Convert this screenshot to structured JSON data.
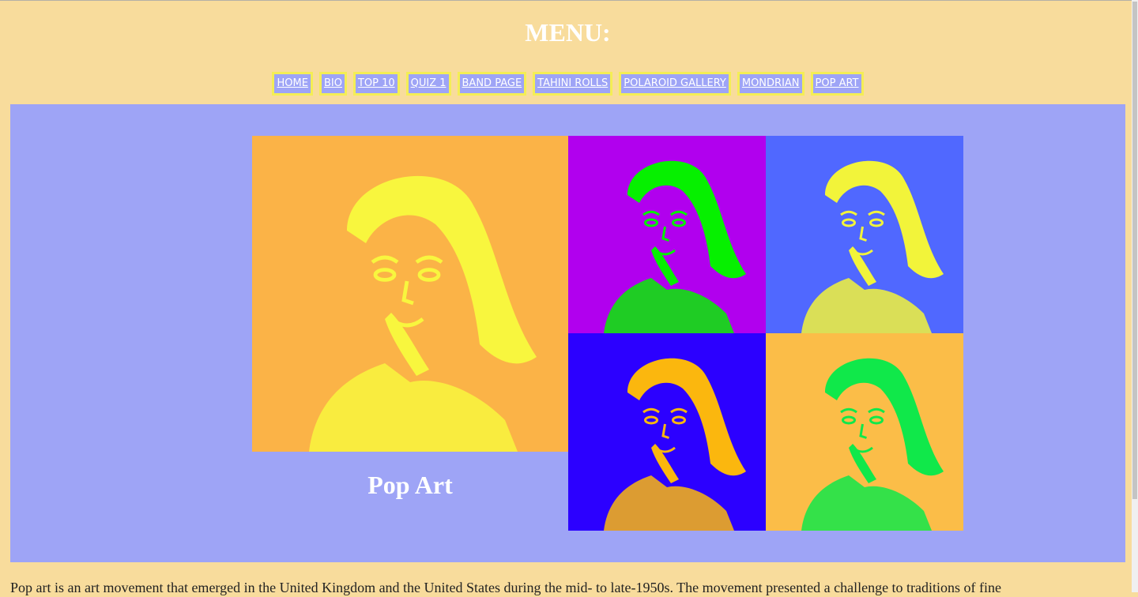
{
  "header": {
    "menu_title": "MENU:"
  },
  "nav": {
    "items": [
      {
        "label": "HOME"
      },
      {
        "label": "BIO"
      },
      {
        "label": "TOP 10"
      },
      {
        "label": "QUIZ 1"
      },
      {
        "label": "BAND PAGE"
      },
      {
        "label": "TAHINI ROLLS"
      },
      {
        "label": "POLAROID GALLERY"
      },
      {
        "label": "MONDRIAN"
      },
      {
        "label": "POP ART"
      }
    ]
  },
  "gallery": {
    "caption": "Pop Art",
    "tiles": [
      {
        "background": "#fbb347",
        "figure": "#f8f63e"
      },
      {
        "background": "#b100ee",
        "figure": "#06f000"
      },
      {
        "background": "#5068ff",
        "figure": "#f2f43a"
      },
      {
        "background": "#2c00ff",
        "figure": "#fbb70e"
      },
      {
        "background": "#fbbd48",
        "figure": "#10e84a"
      }
    ]
  },
  "body_text": "Pop art is an art movement that emerged in the United Kingdom and the United States during the mid- to late-1950s. The movement presented a challenge to traditions of fine",
  "colors": {
    "page_bg": "#f8dc9c",
    "panel_bg": "#9ea4f6",
    "nav_border": "#f4ee55",
    "nav_bg": "#9ea4f6"
  }
}
